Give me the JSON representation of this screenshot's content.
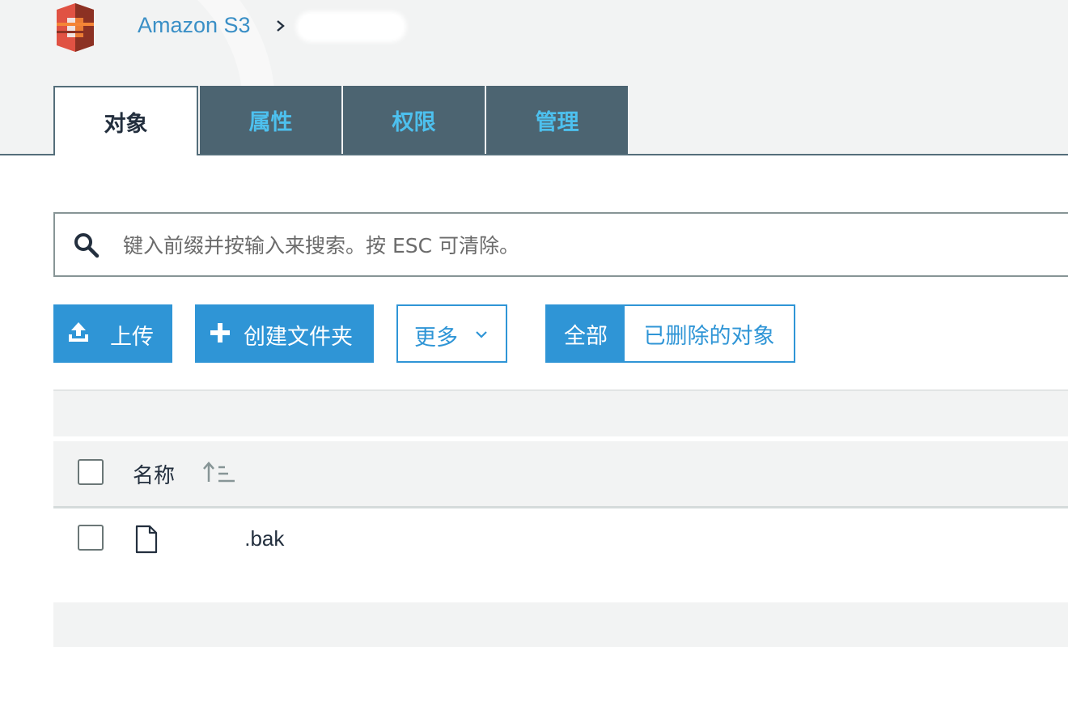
{
  "brand": {
    "logo_icon": "amazon-s3-logo-icon",
    "logo_color": "#e05243"
  },
  "breadcrumb": {
    "service_label": "Amazon S3",
    "separator_icon": "chevron-right-icon",
    "bucket_name": "(redacted)"
  },
  "tabs": [
    {
      "label": "对象",
      "active": true
    },
    {
      "label": "属性",
      "active": false
    },
    {
      "label": "权限",
      "active": false
    },
    {
      "label": "管理",
      "active": false
    }
  ],
  "search": {
    "icon": "search-icon",
    "placeholder": "键入前缀并按输入来搜索。按 ESC 可清除。",
    "value": ""
  },
  "toolbar": {
    "upload_label": "上传",
    "upload_icon": "upload-icon",
    "create_folder_label": "创建文件夹",
    "create_folder_icon": "plus-icon",
    "more_label": "更多",
    "more_icon": "chevron-down-icon",
    "filter_all_label": "全部",
    "filter_deleted_label": "已删除的对象"
  },
  "table": {
    "columns": [
      {
        "label": "名称",
        "sort_icon": "sort-ascending-icon"
      }
    ],
    "rows": [
      {
        "name": "          .bak",
        "icon": "file-icon",
        "checked": false
      }
    ]
  },
  "colors": {
    "accent": "#2f95d6",
    "tab_bg": "#4c6471",
    "tab_text": "#4dc0ee",
    "band_bg": "#f2f3f3"
  }
}
